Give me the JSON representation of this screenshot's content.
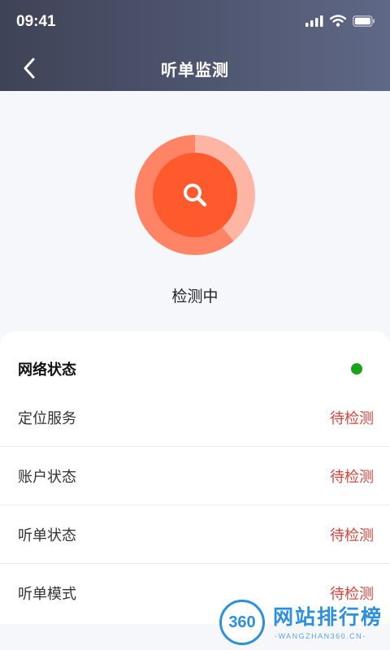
{
  "status_bar": {
    "time": "09:41",
    "icons": [
      "signal-icon",
      "wifi-icon",
      "battery-icon"
    ]
  },
  "nav": {
    "title": "听单监测",
    "back_icon": "chevron-left-icon"
  },
  "scan": {
    "status": "检测中",
    "icon": "search-icon",
    "progress": 0.61,
    "colors": {
      "core": "#ff5a2e",
      "ring": "#ff8466",
      "ring_track": "#ffb5a3"
    }
  },
  "network": {
    "label": "网络状态",
    "indicator_color": "#1aa31a"
  },
  "checks": [
    {
      "label": "定位服务",
      "status": "待检测"
    },
    {
      "label": "账户状态",
      "status": "待检测"
    },
    {
      "label": "听单状态",
      "status": "待检测"
    },
    {
      "label": "听单模式",
      "status": "待检测"
    }
  ],
  "watermark": {
    "logo": "360",
    "name": "网站排行榜",
    "sub": "-WANGZHAN360.CN-"
  },
  "colors": {
    "header_start": "#3e4356",
    "header_end": "#5f6886",
    "pending": "#d8443a",
    "watermark": "#2d8fe0"
  }
}
